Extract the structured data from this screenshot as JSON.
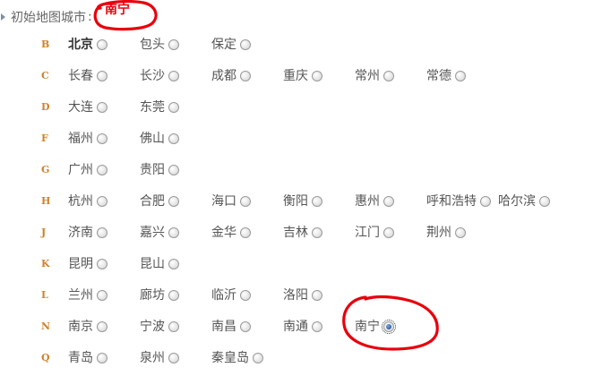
{
  "header": {
    "label": "初始地图城市",
    "colon": ":",
    "current_city": "南宁"
  },
  "annotation_color": "#e8000c",
  "letter_color": "#d0822a",
  "selected_city": "南宁",
  "groups": [
    {
      "letter": "B",
      "cities": [
        "北京",
        "包头",
        "保定"
      ]
    },
    {
      "letter": "C",
      "cities": [
        "长春",
        "长沙",
        "成都",
        "重庆",
        "常州",
        "常德"
      ]
    },
    {
      "letter": "D",
      "cities": [
        "大连",
        "东莞"
      ]
    },
    {
      "letter": "F",
      "cities": [
        "福州",
        "佛山"
      ]
    },
    {
      "letter": "G",
      "cities": [
        "广州",
        "贵阳"
      ]
    },
    {
      "letter": "H",
      "cities": [
        "杭州",
        "合肥",
        "海口",
        "衡阳",
        "惠州",
        "呼和浩特",
        "哈尔滨"
      ]
    },
    {
      "letter": "J",
      "cities": [
        "济南",
        "嘉兴",
        "金华",
        "吉林",
        "江门",
        "荆州"
      ]
    },
    {
      "letter": "K",
      "cities": [
        "昆明",
        "昆山"
      ]
    },
    {
      "letter": "L",
      "cities": [
        "兰州",
        "廊坊",
        "临沂",
        "洛阳"
      ]
    },
    {
      "letter": "N",
      "cities": [
        "南京",
        "宁波",
        "南昌",
        "南通",
        "南宁"
      ]
    },
    {
      "letter": "Q",
      "cities": [
        "青岛",
        "泉州",
        "秦皇岛"
      ]
    }
  ]
}
